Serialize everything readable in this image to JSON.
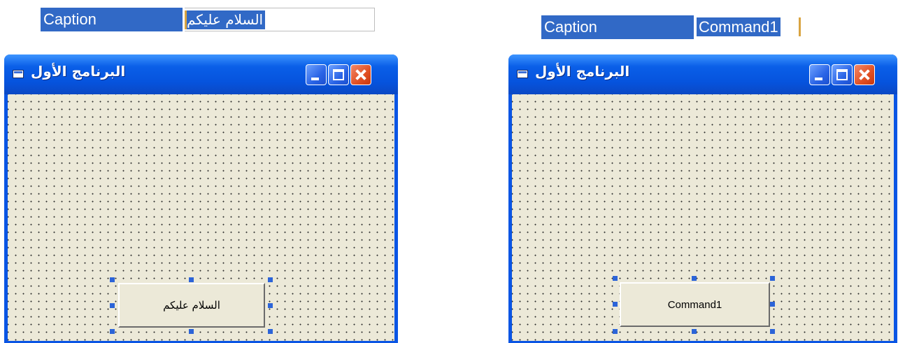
{
  "properties": [
    {
      "name": "Caption",
      "value": "السلام عليكم"
    },
    {
      "name": "Caption",
      "value": "Command1"
    }
  ],
  "forms": [
    {
      "title": "البرنامج الأول",
      "button_caption": "السلام عليكم"
    },
    {
      "title": "البرنامج الأول",
      "button_caption": "Command1"
    }
  ],
  "colors": {
    "titlebar": "#0a55e4",
    "selection": "#3169c6",
    "form_background": "#ece9d8",
    "close_button": "#e14f22",
    "selection_handle": "#2c64d8"
  },
  "icons": [
    "form-app-icon",
    "minimize-icon",
    "maximize-icon",
    "close-icon"
  ]
}
